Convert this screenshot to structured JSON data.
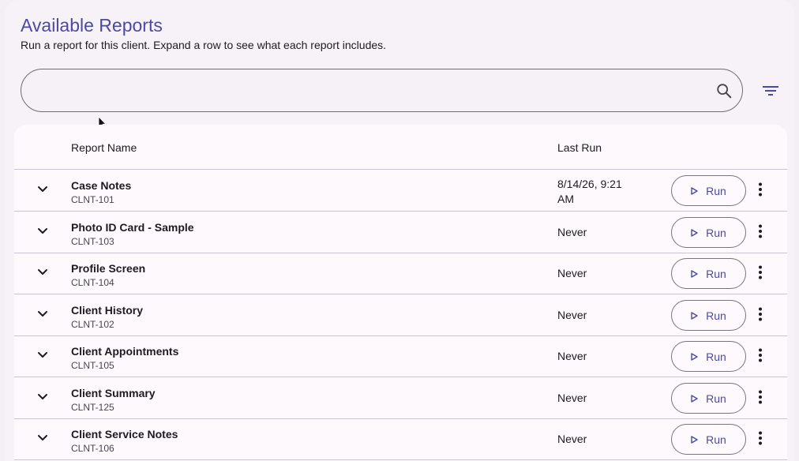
{
  "page": {
    "title": "Available Reports",
    "subtitle": "Run a report for this client. Expand a row to see what each report includes."
  },
  "search": {
    "value": "",
    "placeholder": ""
  },
  "table": {
    "headers": {
      "name": "Report Name",
      "last_run": "Last Run"
    },
    "run_label": "Run",
    "rows": [
      {
        "name": "Case Notes",
        "code": "CLNT-101",
        "last_run_line1": "8/14/26, 9:21",
        "last_run_line2": "AM"
      },
      {
        "name": "Photo ID Card - Sample",
        "code": "CLNT-103",
        "last_run_line1": "Never",
        "last_run_line2": ""
      },
      {
        "name": "Profile Screen",
        "code": "CLNT-104",
        "last_run_line1": "Never",
        "last_run_line2": ""
      },
      {
        "name": "Client History",
        "code": "CLNT-102",
        "last_run_line1": "Never",
        "last_run_line2": ""
      },
      {
        "name": "Client Appointments",
        "code": "CLNT-105",
        "last_run_line1": "Never",
        "last_run_line2": ""
      },
      {
        "name": "Client Summary",
        "code": "CLNT-125",
        "last_run_line1": "Never",
        "last_run_line2": ""
      },
      {
        "name": "Client Service Notes",
        "code": "CLNT-106",
        "last_run_line1": "Never",
        "last_run_line2": ""
      }
    ]
  },
  "icons": {
    "search": "search-icon",
    "filter": "filter-list-icon",
    "expand": "chevron-down-icon",
    "run": "play-icon",
    "more": "more-vert-icon",
    "cursor": "cursor-icon"
  },
  "colors": {
    "accent": "#4c4aa0",
    "background": "#f3eff4",
    "surface": "#fdf9fd",
    "divider": "#cac4d0"
  }
}
